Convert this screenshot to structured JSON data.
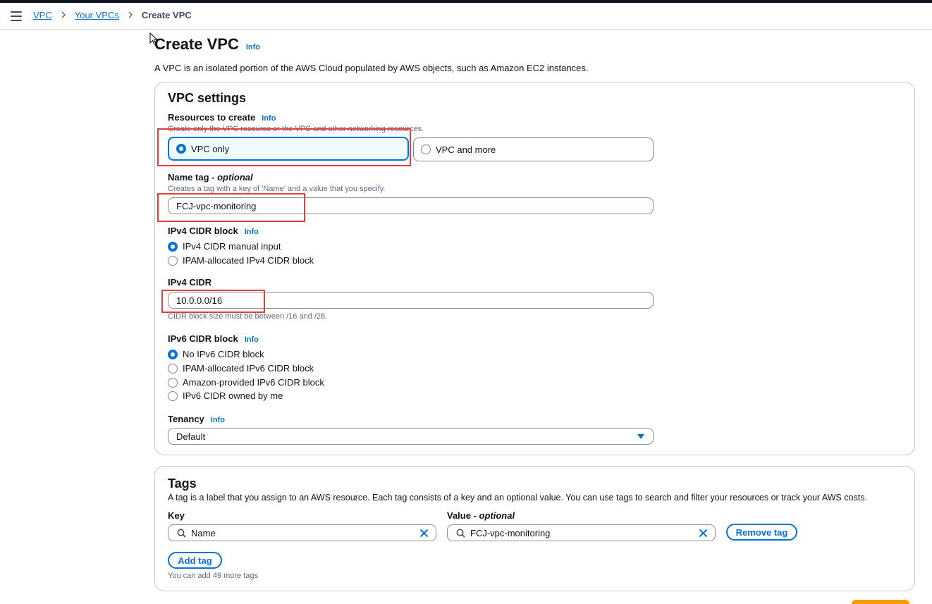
{
  "breadcrumb": {
    "vpc": "VPC",
    "your_vpcs": "Your VPCs",
    "current": "Create VPC",
    "separator": ">"
  },
  "page": {
    "title": "Create VPC",
    "info": "Info",
    "description": "A VPC is an isolated portion of the AWS Cloud populated by AWS objects, such as Amazon EC2 instances."
  },
  "settings": {
    "heading": "VPC settings",
    "resources": {
      "label": "Resources to create",
      "info": "Info",
      "description": "Create only the VPC resource or the VPC and other networking resources.",
      "options": [
        "VPC only",
        "VPC and more"
      ],
      "selected": "VPC only"
    },
    "name_tag": {
      "label": "Name tag - ",
      "optional": "optional",
      "description": "Creates a tag with a key of 'Name' and a value that you specify.",
      "value": "FCJ-vpc-monitoring"
    },
    "ipv4_block": {
      "label": "IPv4 CIDR block",
      "info": "Info",
      "options": [
        "IPv4 CIDR manual input",
        "IPAM-allocated IPv4 CIDR block"
      ],
      "selected": "IPv4 CIDR manual input"
    },
    "ipv4_cidr": {
      "label": "IPv4 CIDR",
      "value": "10.0.0.0/16",
      "constraint": "CIDR block size must be between /16 and /28."
    },
    "ipv6_block": {
      "label": "IPv6 CIDR block",
      "info": "Info",
      "options": [
        "No IPv6 CIDR block",
        "IPAM-allocated IPv6 CIDR block",
        "Amazon-provided IPv6 CIDR block",
        "IPv6 CIDR owned by me"
      ],
      "selected": "No IPv6 CIDR block"
    },
    "tenancy": {
      "label": "Tenancy",
      "info": "Info",
      "value": "Default"
    }
  },
  "tags": {
    "heading": "Tags",
    "description": "A tag is a label that you assign to an AWS resource. Each tag consists of a key and an optional value. You can use tags to search and filter your resources or track your AWS costs.",
    "key_label": "Key",
    "value_label": "Value - ",
    "value_optional": "optional",
    "key_value": "Name",
    "value_value": "FCJ-vpc-monitoring",
    "remove_tag": "Remove tag",
    "add_tag": "Add tag",
    "limit_text": "You can add 49 more tags"
  },
  "colors": {
    "accent": "#0972d3",
    "highlight": "#e03f3f",
    "action": "#ff9900"
  },
  "icons": [
    "menu-icon",
    "chevron-right-icon",
    "radio-icon",
    "caret-down-icon",
    "search-icon",
    "close-icon",
    "mouse-cursor-icon"
  ]
}
